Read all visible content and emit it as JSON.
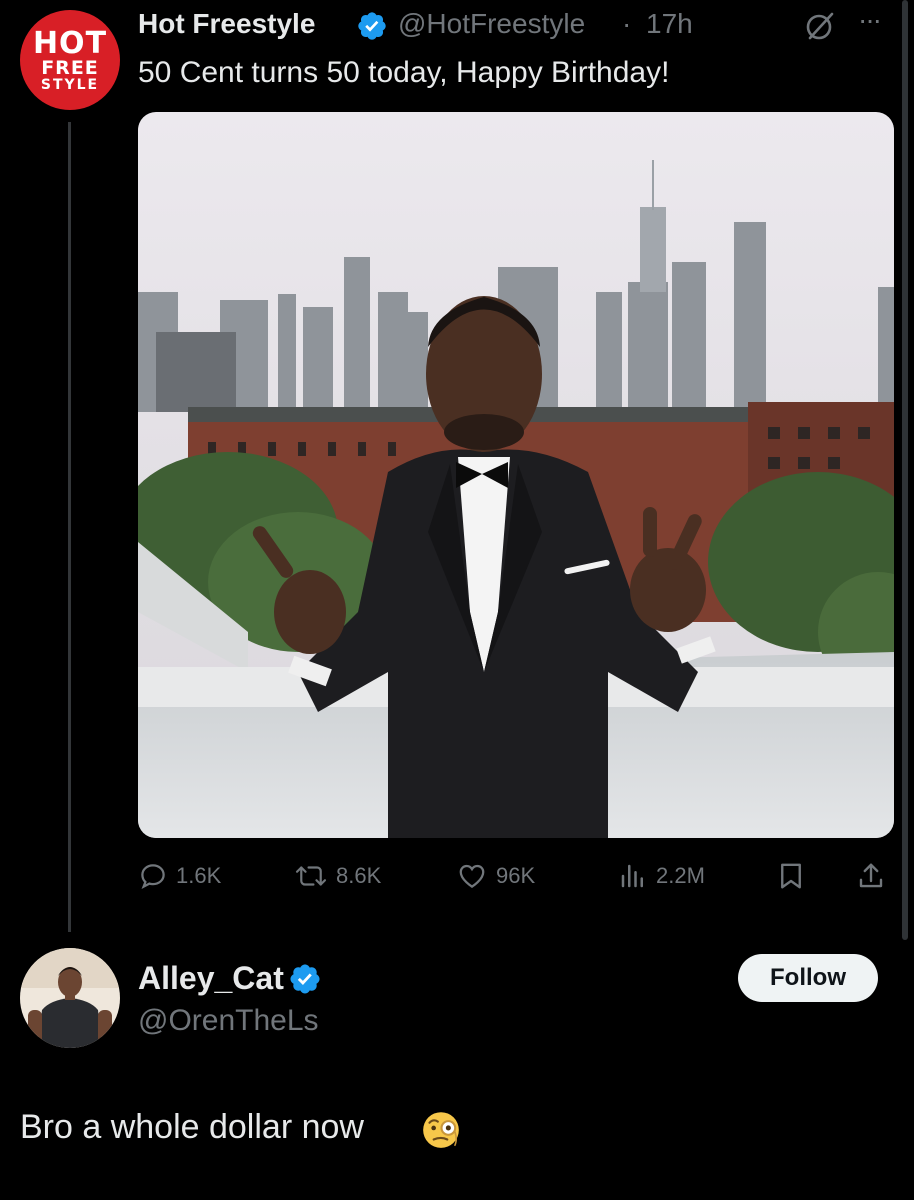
{
  "tweet": {
    "author_name": "Hot Freestyle",
    "handle": "@HotFreestyle",
    "separator": "·",
    "time": "17h",
    "more_label": "···",
    "text": "50 Cent turns 50 today, Happy Birthday!",
    "avatar_logo": [
      "HOT",
      "FREE",
      "STYLE"
    ],
    "actions": {
      "replies": "1.6K",
      "reposts": "8.6K",
      "likes": "96K",
      "views": "2.2M"
    }
  },
  "reply": {
    "author_name": "Alley_Cat",
    "handle": "@OrenTheLs",
    "follow_label": "Follow",
    "text": "Bro a whole dollar now"
  },
  "colors": {
    "background": "#000000",
    "text_primary": "#e7e9ea",
    "text_secondary": "#71767b",
    "verified_blue": "#1d9bf0",
    "logo_red": "#d81f26",
    "follow_bg": "#eff3f4"
  },
  "icons": [
    "verified-badge-icon",
    "grok-icon",
    "more-icon",
    "reply-icon",
    "repost-icon",
    "like-icon",
    "views-icon",
    "bookmark-icon",
    "share-icon",
    "monocle-face-emoji"
  ]
}
